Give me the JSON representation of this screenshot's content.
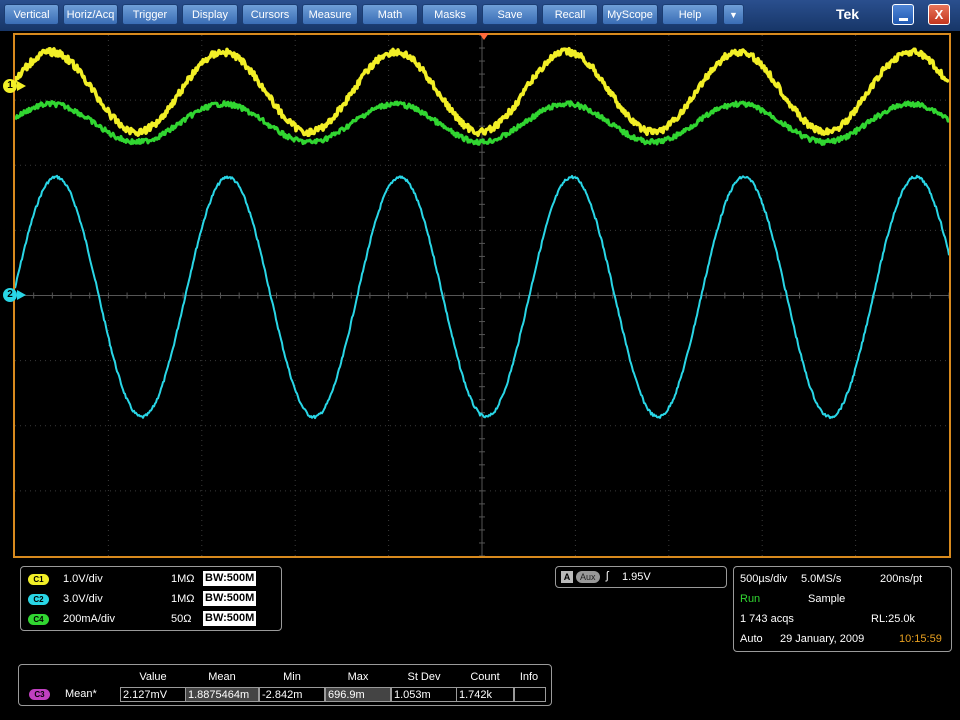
{
  "menu": {
    "items": [
      "Vertical",
      "Horiz/Acq",
      "Trigger",
      "Display",
      "Cursors",
      "Measure",
      "Math",
      "Masks",
      "Save",
      "Recall",
      "MyScope",
      "Help"
    ],
    "dropdown_icon": "chevron-down-icon",
    "dropdown_glyph": "▼",
    "brand": "Tek",
    "minimize_icon": "minimize-icon",
    "close_icon": "close-icon",
    "close_glyph": "X"
  },
  "markers": {
    "ch1": "1",
    "ch2": "2"
  },
  "channels": [
    {
      "badge": "C1",
      "scale": "1.0V/div",
      "impedance": "1MΩ",
      "bandwidth": "BW:500M",
      "color": "#f2ef27"
    },
    {
      "badge": "C2",
      "scale": "3.0V/div",
      "impedance": "1MΩ",
      "bandwidth": "BW:500M",
      "color": "#29d6e6"
    },
    {
      "badge": "C4",
      "scale": "200mA/div",
      "impedance": "50Ω",
      "bandwidth": "BW:500M",
      "color": "#31d631"
    }
  ],
  "trigger": {
    "mode": "A",
    "source": "Aux",
    "slope_icon": "rising-edge-icon",
    "slope_glyph": "ʃ",
    "level": "1.95V"
  },
  "acquisition": {
    "time_per_div": "500µs/div",
    "sample_rate": "5.0MS/s",
    "resolution": "200ns/pt",
    "state": "Run",
    "mode": "Sample",
    "acqs": "1 743 acqs",
    "record_length": "RL:25.0k",
    "trigger_mode": "Auto",
    "date": "29 January, 2009",
    "time": "10:15:59",
    "state_color": "#31d631",
    "time_color": "#e8a020"
  },
  "measurement": {
    "headers": [
      "Value",
      "Mean",
      "Min",
      "Max",
      "St Dev",
      "Count",
      "Info"
    ],
    "badge": "C3",
    "badge_color": "#c040c0",
    "name": "Mean*",
    "values": [
      "2.127mV",
      "1.8875464m",
      "-2.842m",
      "696.9m",
      "1.053m",
      "1.742k",
      ""
    ]
  },
  "colors": {
    "ch1": "#f2ef27",
    "ch2": "#29d6e6",
    "ch4": "#31d631",
    "graticule_border": "#d88a1e",
    "trigger_marker": "#ff6a3a"
  }
}
